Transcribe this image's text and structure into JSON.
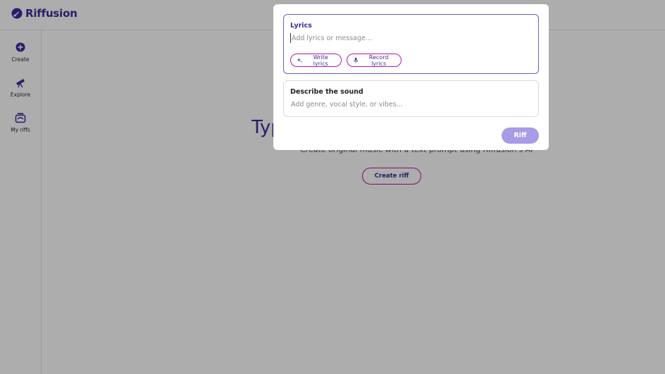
{
  "app": {
    "name": "Riffusion",
    "brand_color": "#3f2a9c",
    "accent_color": "#b5179e"
  },
  "sidebar": {
    "items": [
      {
        "label": "Create",
        "icon": "plus-circle-icon"
      },
      {
        "label": "Explore",
        "icon": "telescope-icon"
      },
      {
        "label": "My riffs",
        "icon": "library-icon"
      }
    ]
  },
  "hero": {
    "title": "Type your riff",
    "subtitle": "Create original music with a text prompt using Riffusion's AI",
    "button_label": "Create riff"
  },
  "modal": {
    "lyrics": {
      "label": "Lyrics",
      "placeholder": "Add lyrics or message...",
      "value": "",
      "write_label": "Write lyrics",
      "record_label": "Record lyrics"
    },
    "sound": {
      "label": "Describe the sound",
      "placeholder": "Add genre, vocal style, or vibes...",
      "value": ""
    },
    "submit_label": "Riff"
  }
}
